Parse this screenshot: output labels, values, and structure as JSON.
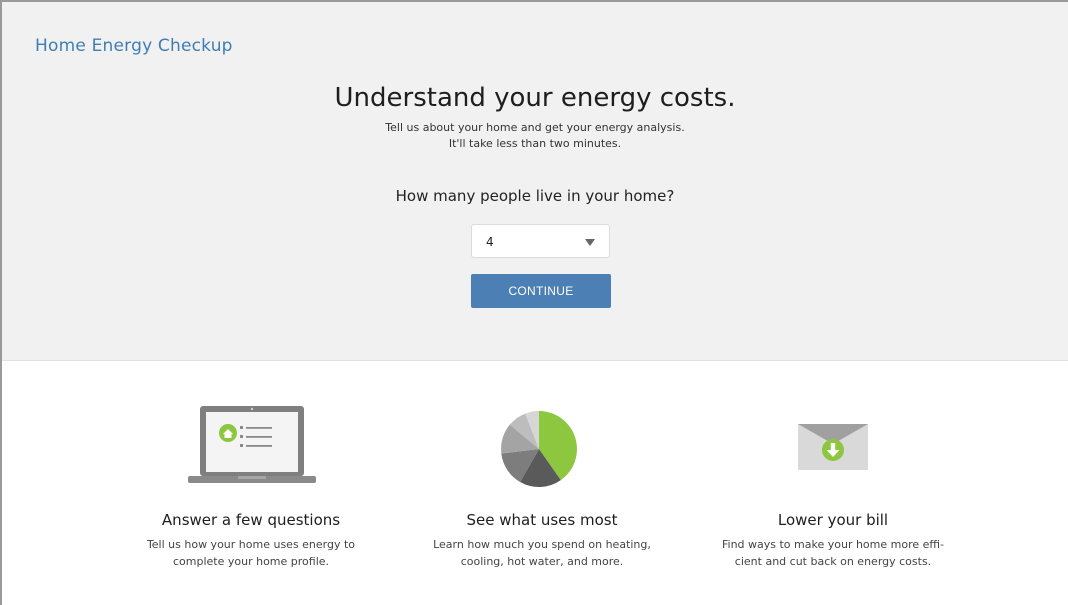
{
  "app": {
    "title": "Home Energy Checkup"
  },
  "hero": {
    "headline": "Understand your energy costs.",
    "subtitle_line1": "Tell us about your home and get your energy analysis.",
    "subtitle_line2": "It'll take less than two minutes."
  },
  "form": {
    "question": "How many people live in your home?",
    "selected_value": "4",
    "continue_label": "CONTINUE"
  },
  "features": [
    {
      "title": "Answer a few questions",
      "desc_line1": "Tell us how your home uses energy to",
      "desc_line2": "complete your home profile.",
      "icon": "laptop-icon"
    },
    {
      "title": "See what uses most",
      "desc_line1": "Learn how much you spend on heating,",
      "desc_line2": "cooling, hot water, and more.",
      "icon": "pie-chart-icon"
    },
    {
      "title": "Lower your bill",
      "desc_line1": "Find ways to make your home more effi-",
      "desc_line2": "cient and cut back on energy costs.",
      "icon": "envelope-download-icon"
    }
  ],
  "colors": {
    "accent": "#4c7fb3",
    "green": "#8dc63f",
    "background_top": "#f1f1f1"
  }
}
